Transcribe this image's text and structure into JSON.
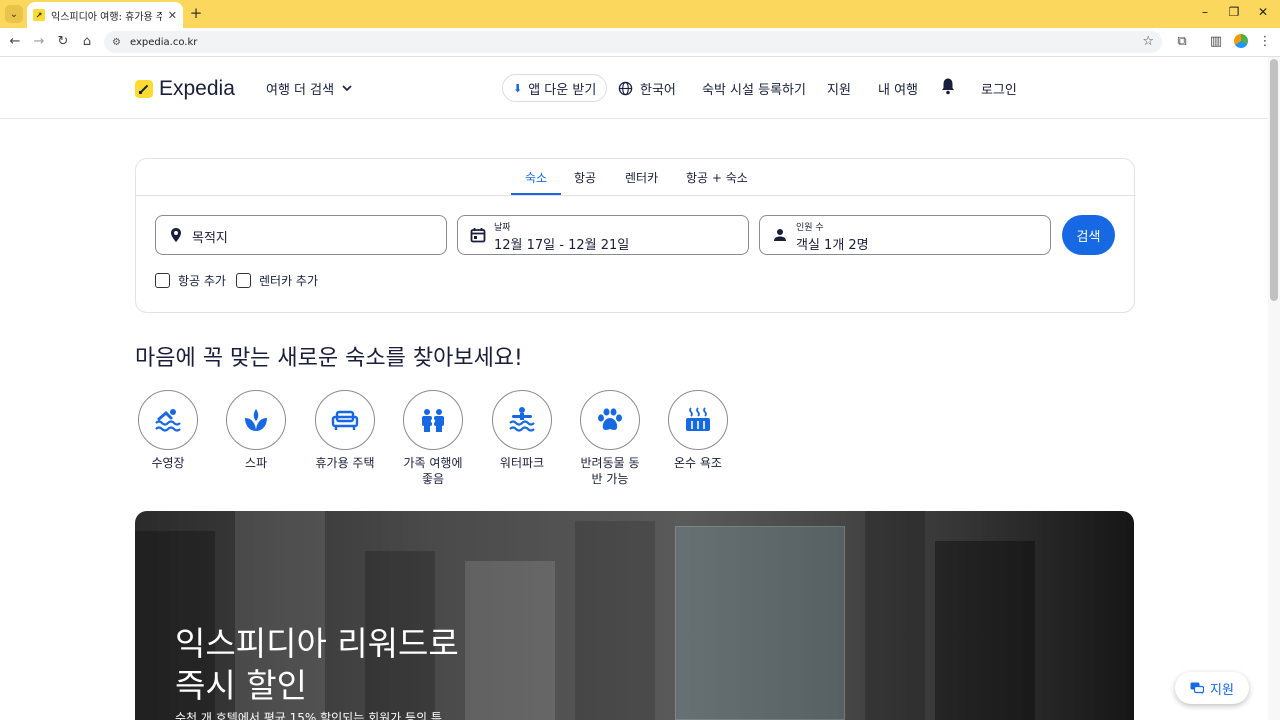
{
  "browser": {
    "tab_title": "익스피디아 여행: 휴가용 주택",
    "url": "expedia.co.kr"
  },
  "header": {
    "logo_text": "Expedia",
    "more_travel": "여행 더 검색",
    "app_download": "앱 다운 받기",
    "language": "한국어",
    "list_property": "숙박 시설 등록하기",
    "support": "지원",
    "my_trips": "내 여행",
    "login": "로그인"
  },
  "search": {
    "tabs": [
      "숙소",
      "항공",
      "렌터카",
      "항공 + 숙소"
    ],
    "active_tab": "숙소",
    "destination_placeholder": "목적지",
    "date_label": "날짜",
    "date_value": "12월 17일 - 12월 21일",
    "guests_label": "인원 수",
    "guests_value": "객실 1개 2명",
    "search_button": "검색",
    "add_flight": "항공 추가",
    "add_car": "렌터카 추가"
  },
  "headline": "마음에 꼭 맞는 새로운 숙소를 찾아보세요!",
  "categories": [
    {
      "label": "수영장",
      "icon": "pool-icon"
    },
    {
      "label": "스파",
      "icon": "spa-icon"
    },
    {
      "label": "휴가용 주택",
      "icon": "sofa-icon"
    },
    {
      "label": "가족 여행에 좋음",
      "icon": "family-icon"
    },
    {
      "label": "워터파크",
      "icon": "waterpark-icon"
    },
    {
      "label": "반려동물 동반 가능",
      "icon": "paw-icon"
    },
    {
      "label": "온수 욕조",
      "icon": "hot-tub-icon"
    }
  ],
  "hero": {
    "title": "익스피디아 리워드로 즉시 할인",
    "subtitle": "수천 개 호텔에서 평균 15% 할인되는 회원가 등의 특"
  },
  "help_float": "지원",
  "colors": {
    "brand_yellow": "#fddb32",
    "brand_navy": "#191e3b",
    "accent_blue": "#1668e3"
  }
}
